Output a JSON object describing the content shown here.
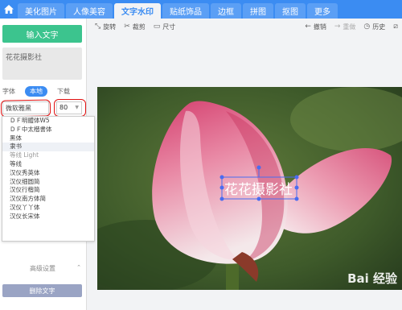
{
  "nav": {
    "tabs": [
      {
        "label": "美化图片"
      },
      {
        "label": "人像美容"
      },
      {
        "label": "文字水印"
      },
      {
        "label": "贴纸饰品"
      },
      {
        "label": "边框"
      },
      {
        "label": "拼图"
      },
      {
        "label": "抠图"
      },
      {
        "label": "更多"
      }
    ],
    "active_index": 2
  },
  "sidebar": {
    "add_text_label": "输入文字",
    "text_value": "花花摄影社",
    "font_label": "字体",
    "font_source_local": "本地",
    "font_source_download": "下载",
    "font_value": "微软雅黑",
    "size_value": "80",
    "font_options": [
      {
        "label": "ＤＦ明體体W5"
      },
      {
        "label": "ＤＦ中太楷書体"
      },
      {
        "label": "黑体"
      },
      {
        "label": "隶书"
      },
      {
        "label": "等线 Light"
      },
      {
        "label": "等线"
      },
      {
        "label": "汉仪秀英体"
      },
      {
        "label": "汉仪细圆简"
      },
      {
        "label": "汉仪行楷简"
      },
      {
        "label": "汉仪南方体简"
      },
      {
        "label": "汉仪丫丫体"
      },
      {
        "label": "汉仪长宋体"
      }
    ],
    "advanced_label": "高级设置",
    "delete_text_label": "删除文字"
  },
  "toolbar": {
    "rotate_label": "旋转",
    "crop_label": "裁剪",
    "size_label": "尺寸",
    "undo_label": "撤销",
    "redo_label": "重做",
    "history_label": "历史"
  },
  "canvas": {
    "watermark_text": "花花摄影社",
    "site_watermark": "Bai 经验"
  },
  "colors": {
    "nav_blue": "#3b8cf2",
    "primary_green": "#3cc48e",
    "annotation_red": "#e01010",
    "selection_blue": "#4a6cf0"
  }
}
